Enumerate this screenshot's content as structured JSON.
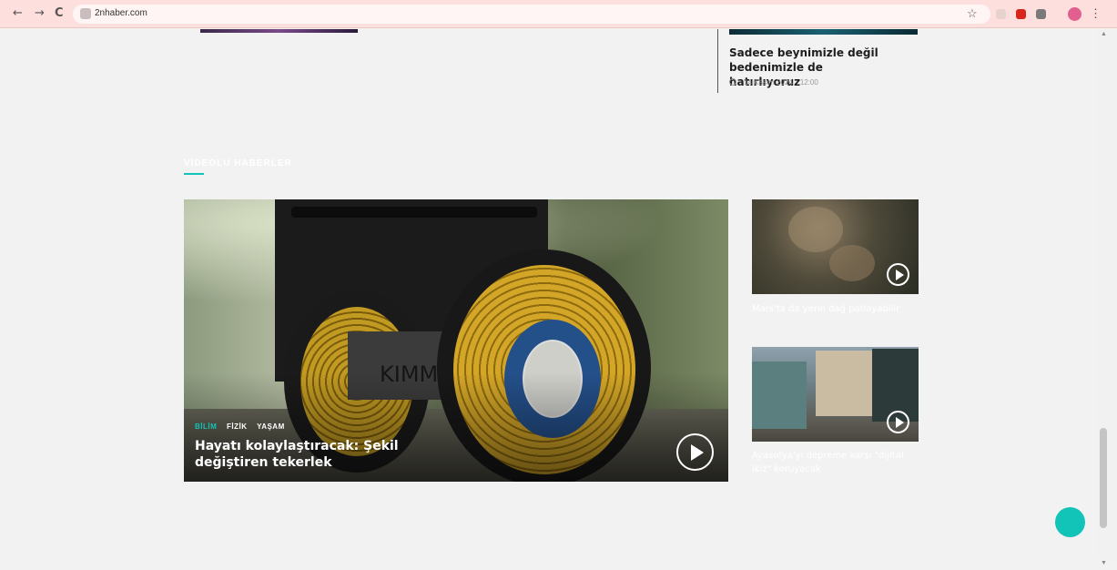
{
  "browser": {
    "url": "2nhaber.com",
    "back_glyph": "←",
    "forward_glyph": "→",
    "reload_glyph": "C",
    "star_glyph": "☆",
    "menu_glyph": "⋮"
  },
  "previous_section": {
    "side_article": {
      "title": "Sadece beynimizle değil bedenimizle de hatırlıyoruz",
      "date": "14 Kasım 2024",
      "time": "12:00"
    }
  },
  "video_section": {
    "title": "VİDEOLU HABERLER",
    "accent_color": "#12c3b8",
    "main": {
      "tags": [
        "BİLİM",
        "FİZİK",
        "YAŞAM"
      ],
      "title": "Hayatı kolaylaştıracak: Şekil değiştiren tekerlek",
      "plate_text": "KIMM"
    },
    "side": [
      {
        "title": "Mars'ta da yerin dağ patlayabilir"
      },
      {
        "title": "Ayasofya'yı depreme karşı \"dijital ikiz\" koruyacak"
      }
    ]
  }
}
